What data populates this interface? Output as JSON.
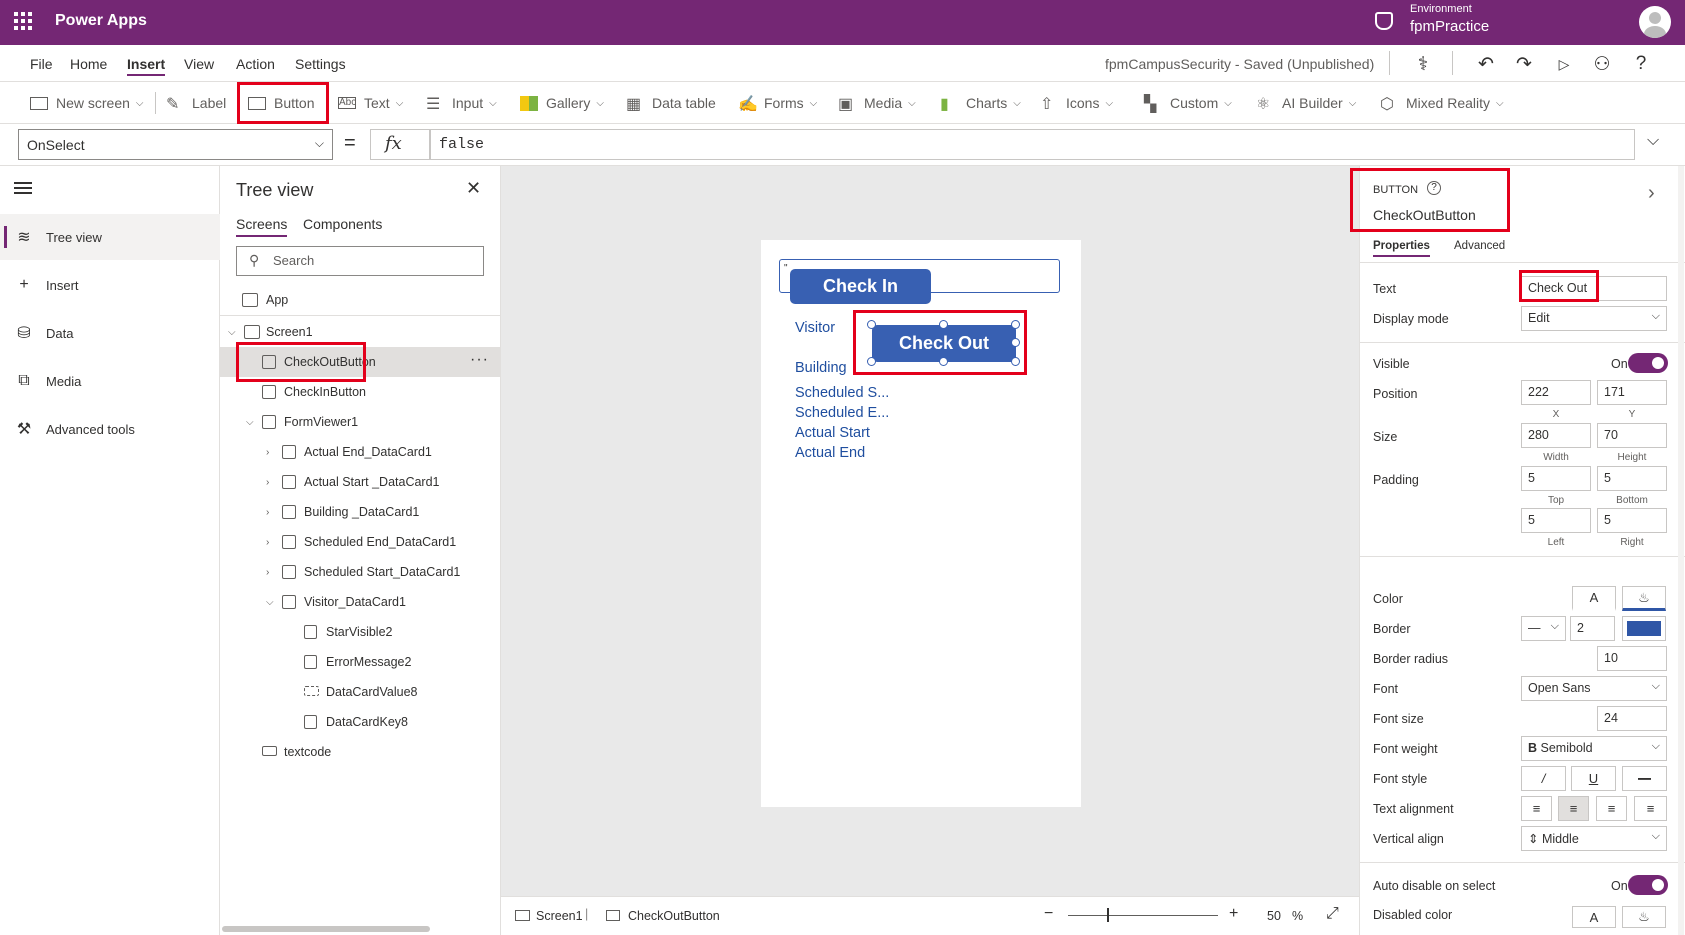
{
  "app": {
    "name": "Power Apps",
    "env_label": "Environment",
    "env_name": "fpmPractice"
  },
  "menu": {
    "items": [
      "File",
      "Home",
      "Insert",
      "View",
      "Action",
      "Settings"
    ],
    "active": "Insert",
    "status": "fpmCampusSecurity - Saved (Unpublished)"
  },
  "ribbon": {
    "new_screen": "New screen",
    "label": "Label",
    "button": "Button",
    "text": "Text",
    "input": "Input",
    "gallery": "Gallery",
    "data_table": "Data table",
    "forms": "Forms",
    "media": "Media",
    "charts": "Charts",
    "icons": "Icons",
    "custom": "Custom",
    "ai_builder": "AI Builder",
    "mixed_reality": "Mixed Reality"
  },
  "formula": {
    "property": "OnSelect",
    "equals": "=",
    "fx": "fx",
    "value": "false"
  },
  "leftnav": {
    "items": [
      "Tree view",
      "Insert",
      "Data",
      "Media",
      "Advanced tools"
    ]
  },
  "tree": {
    "title": "Tree view",
    "tab_screens": "Screens",
    "tab_components": "Components",
    "search_placeholder": "Search",
    "app": "App",
    "screen1": "Screen1",
    "checkout": "CheckOutButton",
    "checkin": "CheckInButton",
    "formviewer": "FormViewer1",
    "card1": "Actual End_DataCard1",
    "card2": "Actual Start _DataCard1",
    "card3": "Building _DataCard1",
    "card4": "Scheduled End_DataCard1",
    "card5": "Scheduled Start_DataCard1",
    "card6": "Visitor_DataCard1",
    "sv": "StarVisible2",
    "em": "ErrorMessage2",
    "dcv": "DataCardValue8",
    "dck": "DataCardKey8",
    "textcode": "textcode",
    "more": "···"
  },
  "canvas": {
    "check_in": "Check In",
    "check_out": "Check Out",
    "visitor": "Visitor",
    "building": "Building",
    "sched_start": "Scheduled S...",
    "sched_end": "Scheduled E...",
    "actual_start": "Actual Start",
    "actual_end": "Actual End",
    "input_mark": "\""
  },
  "statusbar": {
    "screen": "Screen1",
    "control": "CheckOutButton",
    "zoom": "50",
    "zoom_unit": "%"
  },
  "props": {
    "type": "BUTTON",
    "name": "CheckOutButton",
    "tab_properties": "Properties",
    "tab_advanced": "Advanced",
    "text_label": "Text",
    "text_value": "Check Out",
    "display_mode_label": "Display mode",
    "display_mode_value": "Edit",
    "visible_label": "Visible",
    "visible_value": "On",
    "position_label": "Position",
    "x": "222",
    "y": "171",
    "x_label": "X",
    "y_label": "Y",
    "size_label": "Size",
    "width": "280",
    "height": "70",
    "width_label": "Width",
    "height_label": "Height",
    "padding_label": "Padding",
    "pad_top": "5",
    "pad_bottom": "5",
    "pad_left": "5",
    "pad_right": "5",
    "top_label": "Top",
    "bottom_label": "Bottom",
    "left_label": "Left",
    "right_label": "Right",
    "color_label": "Color",
    "color_a": "A",
    "border_label": "Border",
    "border_width": "2",
    "border_color": "#2f56a6",
    "border_radius_label": "Border radius",
    "border_radius": "10",
    "font_label": "Font",
    "font_value": "Open Sans",
    "font_size_label": "Font size",
    "font_size": "24",
    "font_weight_label": "Font weight",
    "font_weight": "Semibold",
    "font_weight_b": "B",
    "font_style_label": "Font style",
    "italic": "/",
    "underline": "U",
    "strike": "—",
    "text_align_label": "Text alignment",
    "valign_label": "Vertical align",
    "valign": "Middle",
    "auto_disable_label": "Auto disable on select",
    "auto_disable_value": "On",
    "disabled_color_label": "Disabled color"
  },
  "colors": {
    "brand": "#742774",
    "button": "#3860b2",
    "highlight": "#e3001b"
  }
}
